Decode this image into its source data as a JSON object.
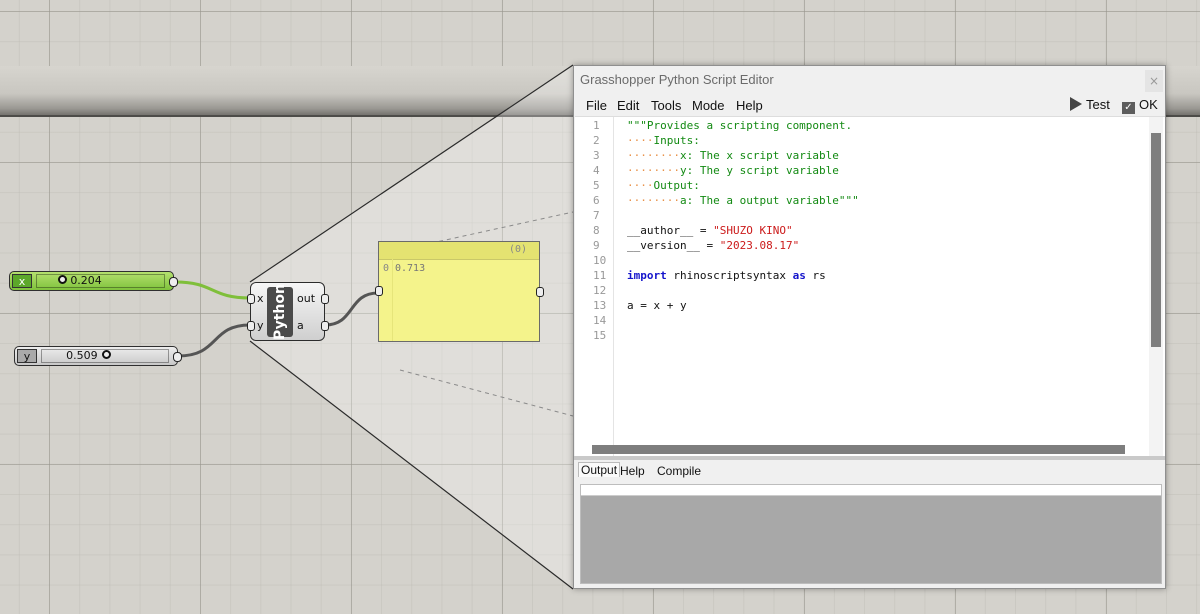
{
  "canvas": {
    "background": "#d4d2cc"
  },
  "slider_x": {
    "tag": "x",
    "value": "0.204",
    "fraction": 0.204,
    "color": "#8bcb46"
  },
  "slider_y": {
    "tag": "y",
    "value": "0.509",
    "fraction": 0.509,
    "color": "#d8d8d8"
  },
  "python_component": {
    "label": "Python",
    "input_x": "x",
    "input_y": "y",
    "output_out": "out",
    "output_a": "a"
  },
  "panel": {
    "count": "(0)",
    "index": "0",
    "value": "0.713",
    "color": "#f4f38b"
  },
  "editor": {
    "title": "Grasshopper Python Script Editor",
    "close": "×",
    "menu": {
      "file": "File",
      "edit": "Edit",
      "tools": "Tools",
      "mode": "Mode",
      "help": "Help"
    },
    "toolbar": {
      "test": "Test",
      "ok": "OK"
    },
    "line_numbers": [
      "1",
      "2",
      "3",
      "4",
      "5",
      "6",
      "7",
      "8",
      "9",
      "10",
      "11",
      "12",
      "13",
      "14",
      "15"
    ],
    "code": {
      "l1": "\"\"\"Provides a scripting component.",
      "l2_dots": "····",
      "l2": "Inputs:",
      "l3_dots": "········",
      "l3": "x: The x script variable",
      "l4_dots": "········",
      "l4": "y: The y script variable",
      "l5_dots": "····",
      "l5": "Output:",
      "l6_dots": "········",
      "l6": "a: The a output variable\"\"\"",
      "l8_name": "__author__",
      "l8_eq": " = ",
      "l8_val": "\"SHUZO KINO\"",
      "l9_name": "__version__",
      "l9_eq": " = ",
      "l9_val": "\"2023.08.17\"",
      "l11_kw1": "import",
      "l11_mod": " rhinoscriptsyntax ",
      "l11_kw2": "as",
      "l11_alias": " rs",
      "l13": "a = x + y"
    },
    "output_tabs": {
      "output": "Output",
      "help": "Help",
      "compile": "Compile"
    }
  }
}
